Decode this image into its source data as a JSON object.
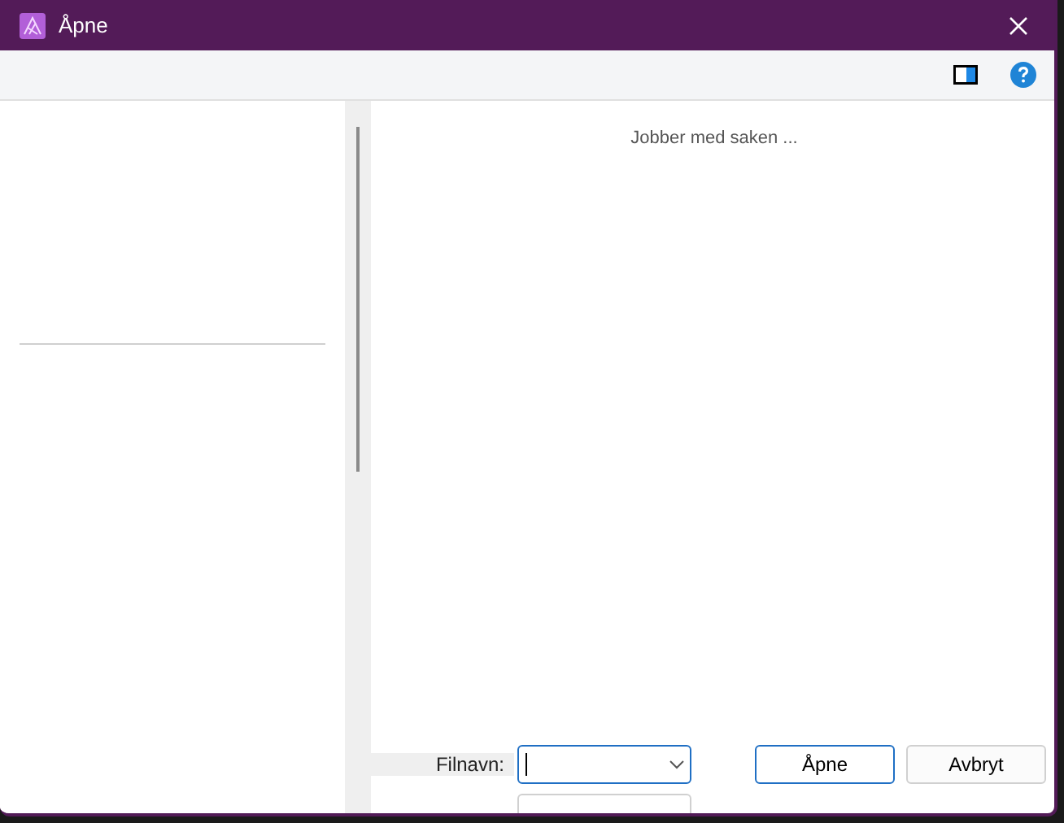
{
  "window": {
    "title": "Åpne"
  },
  "content": {
    "status": "Jobber med saken ..."
  },
  "filename": {
    "label": "Filnavn:"
  },
  "buttons": [
    {
      "label": "Åpne",
      "kind": "primary"
    },
    {
      "label": "Avbryt",
      "kind": "secondary"
    }
  ]
}
